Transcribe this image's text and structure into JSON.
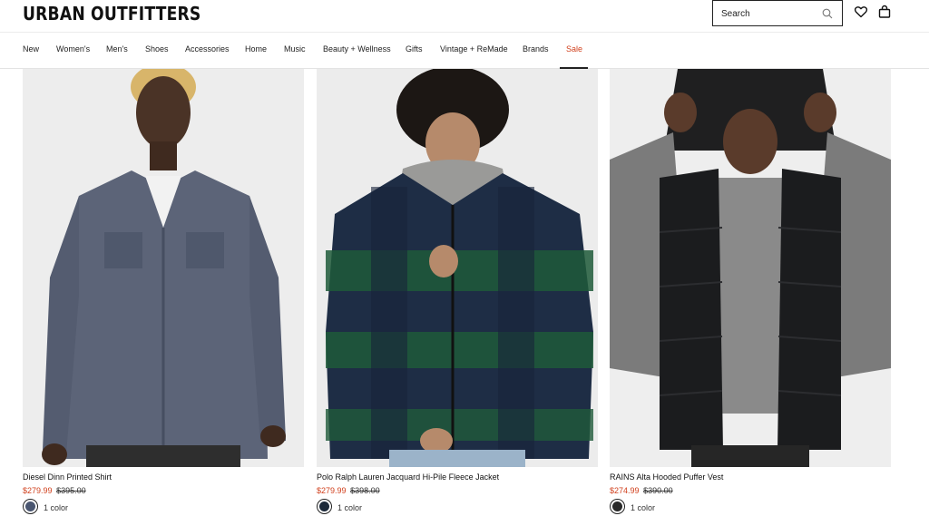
{
  "header": {
    "logo": "URBAN OUTFITTERS",
    "search_placeholder": "Search",
    "icons": [
      "search-icon",
      "heart-icon",
      "bag-icon"
    ]
  },
  "nav": {
    "items": [
      "New",
      "Women's",
      "Men's",
      "Shoes",
      "Accessories",
      "Home",
      "Music",
      "Beauty + Wellness",
      "Gifts",
      "Vintage + ReMade",
      "Brands",
      "Sale"
    ],
    "active": "Sale",
    "sale_color": "#d1411e"
  },
  "products": [
    {
      "name": "Diesel Dinn Printed Shirt",
      "sale_price": "$279.99",
      "original_price": "$395.00",
      "colors": "1 color",
      "swatch_color": "#4a5670"
    },
    {
      "name": "Polo Ralph Lauren Jacquard Hi-Pile Fleece Jacket",
      "sale_price": "$279.99",
      "original_price": "$398.00",
      "colors": "1 color",
      "swatch_color": "#1d2a3a"
    },
    {
      "name": "RAINS Alta Hooded Puffer Vest",
      "sale_price": "$274.99",
      "original_price": "$390.00",
      "colors": "1 color",
      "swatch_color": "#2a2a2a"
    }
  ]
}
